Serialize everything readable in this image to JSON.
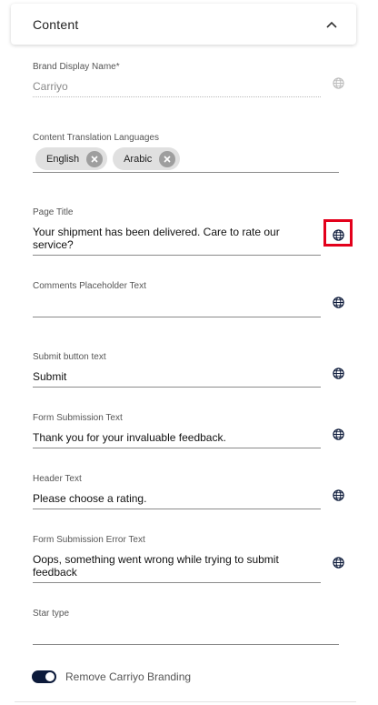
{
  "section": {
    "title": "Content"
  },
  "fields": {
    "brand_display_name": {
      "label": "Brand Display Name",
      "required_mark": "*",
      "value": "Carriyo"
    },
    "translation_languages": {
      "label": "Content Translation Languages",
      "chips": [
        "English",
        "Arabic"
      ]
    },
    "page_title": {
      "label": "Page Title",
      "value_line1": "Your shipment has been delivered. Care to rate our",
      "value_line2": "service?"
    },
    "comments_placeholder": {
      "label": "Comments Placeholder Text",
      "value": ""
    },
    "submit_button_text": {
      "label": "Submit button text",
      "value": "Submit"
    },
    "form_submission_text": {
      "label": "Form Submission Text",
      "value": "Thank you for your invaluable feedback."
    },
    "header_text": {
      "label": "Header Text",
      "value": "Please choose a rating."
    },
    "form_submission_error": {
      "label": "Form Submission Error Text",
      "value_line1": "Oops, something went wrong while trying to submit",
      "value_line2": "feedback"
    },
    "star_type": {
      "label": "Star type",
      "value": ""
    }
  },
  "toggle": {
    "label": "Remove Carriyo Branding",
    "on": true
  },
  "colors": {
    "toggle_on": "#0c1a3a",
    "highlight": "#e3001b",
    "chip_bg": "#e0e0e0"
  },
  "icons": {
    "globe": "globe-icon",
    "chevron": "chevron-up-icon",
    "chip_remove": "close-circle-icon"
  }
}
